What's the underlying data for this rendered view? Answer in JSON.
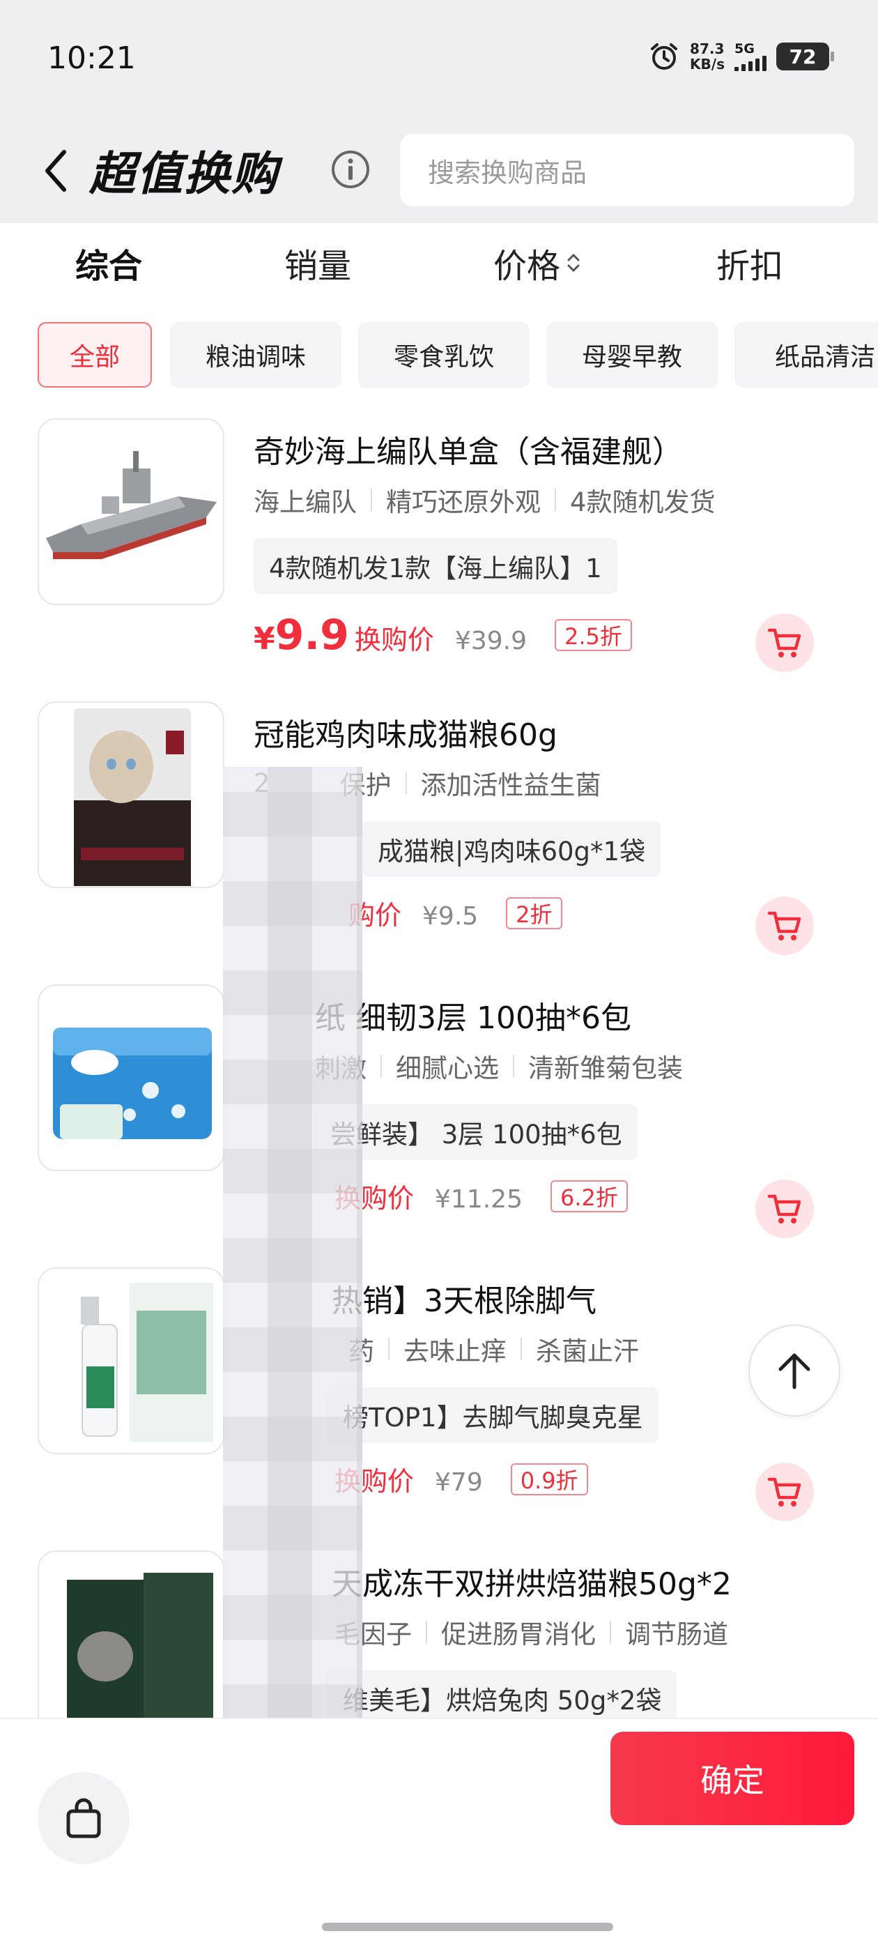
{
  "status_bar": {
    "time": "10:21",
    "speed_value": "87.3",
    "speed_unit": "KB/s",
    "network": "5G",
    "battery": "72"
  },
  "header": {
    "title": "超值换购",
    "search_placeholder": "搜索换购商品"
  },
  "sort_tabs": [
    {
      "label": "综合",
      "active": true
    },
    {
      "label": "销量",
      "active": false
    },
    {
      "label": "价格",
      "active": false
    },
    {
      "label": "折扣",
      "active": false
    }
  ],
  "category_chips": [
    {
      "label": "全部",
      "active": true
    },
    {
      "label": "粮油调味",
      "active": false
    },
    {
      "label": "零食乳饮",
      "active": false
    },
    {
      "label": "母婴早教",
      "active": false
    },
    {
      "label": "纸品清洁",
      "active": false
    }
  ],
  "products": [
    {
      "title": "奇妙海上编队单盒（含福建舰）",
      "tags": [
        "海上编队",
        "精巧还原外观",
        "4款随机发货"
      ],
      "spec": "4款随机发1款【海上编队】1",
      "price_currency": "¥",
      "price": "9.9",
      "price_label": "换购价",
      "original_price": "¥39.9",
      "discount": "2.5折",
      "thumb": "warship"
    },
    {
      "title": "冠能鸡肉味成猫粮60g",
      "tags": [
        "2",
        "保护",
        "添加活性益生菌"
      ],
      "spec": "成猫粮|鸡肉味60g*1袋",
      "price_currency": "",
      "price": "",
      "price_label": "购价",
      "original_price": "¥9.5",
      "discount": "2折",
      "thumb": "catfood"
    },
    {
      "title": "纸 细韧3层 100抽*6包",
      "tags": [
        "刺激",
        "细腻心选",
        "清新雏菊包装"
      ],
      "spec": "尝鲜装】 3层 100抽*6包",
      "price_currency": "",
      "price": "",
      "price_label": "换购价",
      "original_price": "¥11.25",
      "discount": "6.2折",
      "thumb": "tissue"
    },
    {
      "title": "热销】3天根除脚气",
      "tags": [
        "药",
        "去味止痒",
        "杀菌止汗"
      ],
      "spec": "榜TOP1】去脚气脚臭克星",
      "price_currency": "",
      "price": "",
      "price_label": "换购价",
      "original_price": "¥79",
      "discount": "0.9折",
      "thumb": "spray"
    },
    {
      "title": "天成冻干双拼烘焙猫粮50g*2",
      "tags": [
        "毛因子",
        "促进肠胃消化",
        "调节肠道"
      ],
      "spec": "维美毛】烘焙兔肉 50g*2袋",
      "thumb": "catfood2"
    }
  ],
  "bottom_bar": {
    "confirm_label": "确定"
  },
  "colors": {
    "accent": "#f02e3c",
    "header_bg": "#efeff1",
    "chip_bg": "#f4f4f6"
  }
}
